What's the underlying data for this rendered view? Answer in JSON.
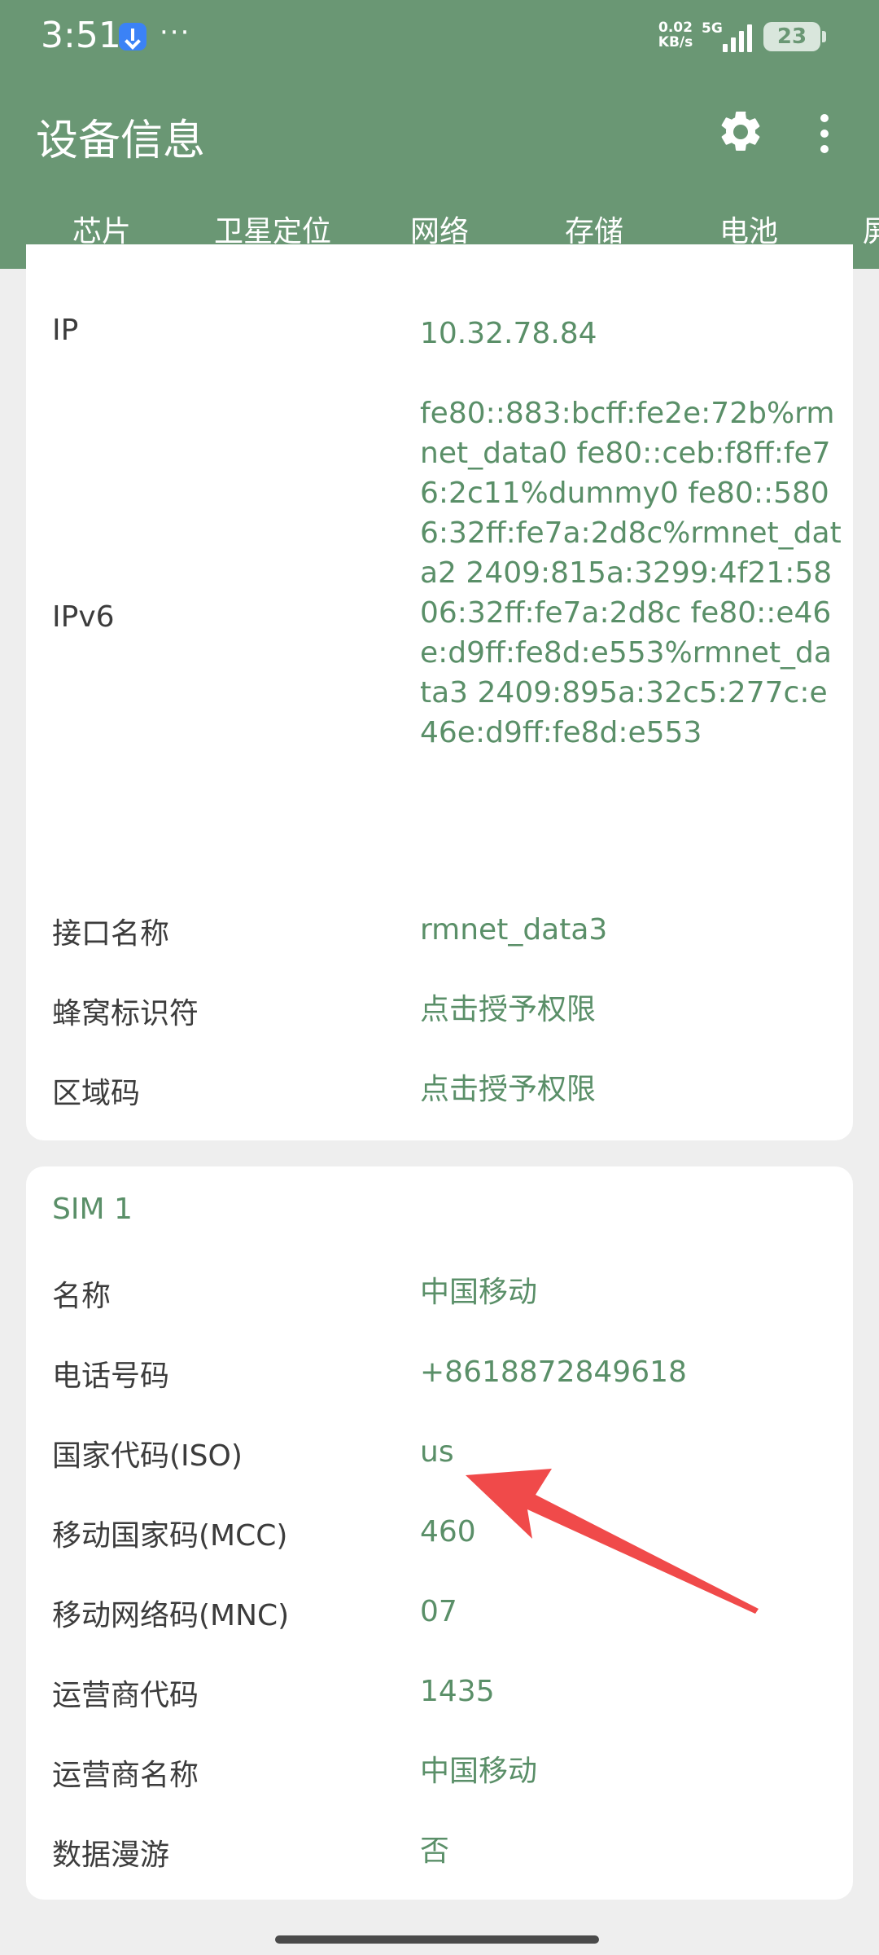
{
  "status_bar": {
    "time": "3:51",
    "more": "···",
    "speed_value": "0.02",
    "speed_unit": "KB/s",
    "network_type": "5G",
    "battery": "23"
  },
  "header": {
    "title": "设备信息",
    "icons": [
      "gear-icon",
      "more-vert-icon"
    ]
  },
  "tabs": [
    {
      "label": "芯片"
    },
    {
      "label": "卫星定位"
    },
    {
      "label": "网络",
      "active": true
    },
    {
      "label": "存储"
    },
    {
      "label": "电池"
    },
    {
      "label": "屏"
    }
  ],
  "network_card": {
    "rows": [
      {
        "label": "IP",
        "value": "10.32.78.84"
      },
      {
        "label": "IPv6",
        "value": "fe80::883:bcff:fe2e:72b%rmnet_data0 fe80::ceb:f8ff:fe76:2c11%dummy0 fe80::5806:32ff:fe7a:2d8c%rmnet_data2 2409:815a:3299:4f21:5806:32ff:fe7a:2d8c fe80::e46e:d9ff:fe8d:e553%rmnet_data3 2409:895a:32c5:277c:e46e:d9ff:fe8d:e553"
      },
      {
        "label": "接口名称",
        "value": "rmnet_data3"
      },
      {
        "label": "蜂窝标识符",
        "value": "点击授予权限"
      },
      {
        "label": "区域码",
        "value": "点击授予权限"
      }
    ]
  },
  "sim_card": {
    "title": "SIM 1",
    "rows": [
      {
        "label": "名称",
        "value": "中国移动"
      },
      {
        "label": "电话号码",
        "value": "+8618872849618"
      },
      {
        "label": "国家代码(ISO)",
        "value": "us"
      },
      {
        "label": "移动国家码(MCC)",
        "value": "460"
      },
      {
        "label": "移动网络码(MNC)",
        "value": "07"
      },
      {
        "label": "运营商代码",
        "value": "1435"
      },
      {
        "label": "运营商名称",
        "value": "中国移动"
      },
      {
        "label": "数据漫游",
        "value": "否"
      }
    ]
  },
  "colors": {
    "app_bar": "#6a9774",
    "value_text": "#5a8f68",
    "annotation_arrow": "#f04a4a"
  }
}
